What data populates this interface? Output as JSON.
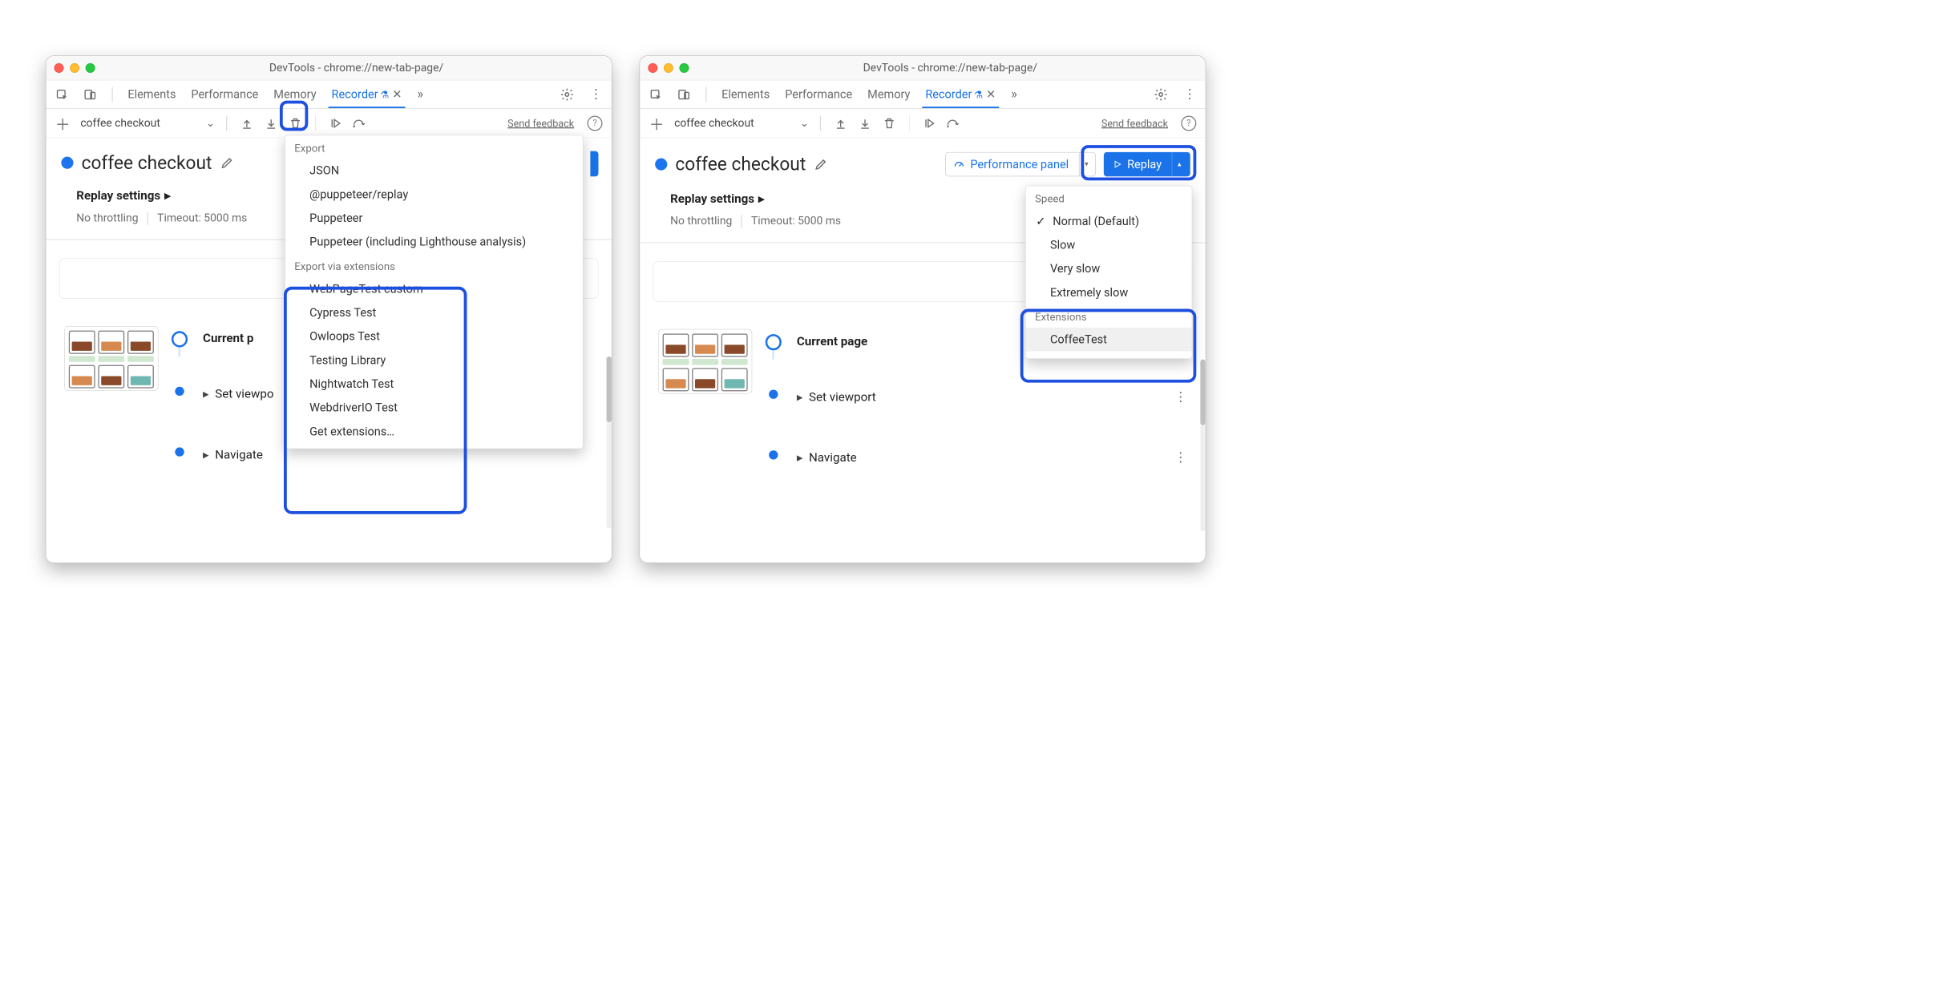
{
  "window_title": "DevTools - chrome://new-tab-page/",
  "tabs": [
    "Elements",
    "Performance",
    "Memory",
    "Recorder"
  ],
  "tool_selector": "coffee checkout",
  "send_feedback": "Send feedback",
  "recording_name": "coffee checkout",
  "replay_settings_label": "Replay settings",
  "throttle_left": "No throttling",
  "throttle_right": "Timeout: 5000 ms",
  "perf_panel_label": "Performance panel",
  "replay_label": "Replay",
  "steps": {
    "current": "Current page",
    "viewport": "Set viewport",
    "navigate": "Navigate"
  },
  "steps_partial": {
    "current": "Current p",
    "viewport": "Set viewpo",
    "navigate": "Navigate"
  },
  "export_menu": {
    "hdr1": "Export",
    "items1": [
      "JSON",
      "@puppeteer/replay",
      "Puppeteer",
      "Puppeteer (including Lighthouse analysis)"
    ],
    "hdr2": "Export via extensions",
    "items2": [
      "WebPageTest custom",
      "Cypress Test",
      "Owloops Test",
      "Testing Library",
      "Nightwatch Test",
      "WebdriverIO Test",
      "Get extensions…"
    ]
  },
  "replay_menu": {
    "hdr1": "Speed",
    "items1": [
      "Normal (Default)",
      "Slow",
      "Very slow",
      "Extremely slow"
    ],
    "hdr2": "Extensions",
    "items2": [
      "CoffeeTest"
    ]
  }
}
